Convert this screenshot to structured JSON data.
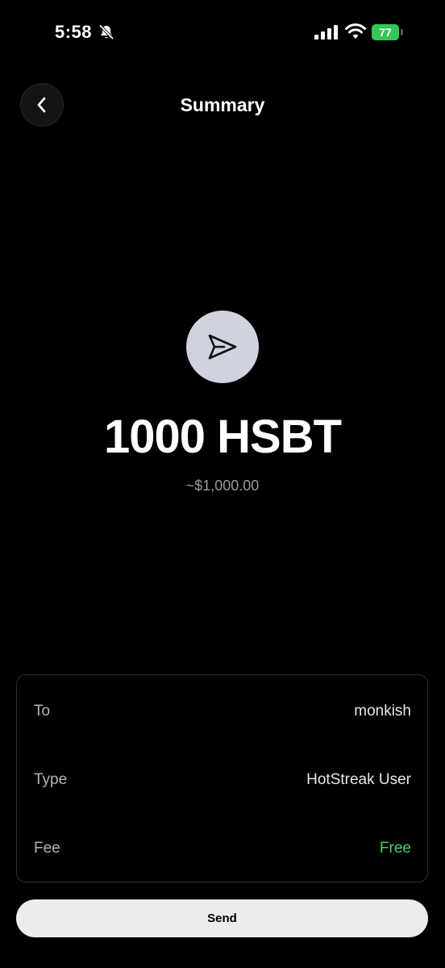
{
  "status_bar": {
    "time": "5:58",
    "battery": "77",
    "icons": [
      "bell-slash-icon",
      "cellular-signal-icon",
      "wifi-icon",
      "battery-charging-icon"
    ]
  },
  "header": {
    "back_icon": "chevron-left-icon",
    "title": "Summary"
  },
  "transaction": {
    "icon": "send-arrow-icon",
    "amount": "1000 HSBT",
    "fiat_value": "~$1,000.00"
  },
  "details": [
    {
      "label": "To",
      "value": "monkish"
    },
    {
      "label": "Type",
      "value": "HotStreak User"
    },
    {
      "label": "Fee",
      "value": "Free"
    }
  ],
  "colors": {
    "background": "#000000",
    "free_accent": "#4ccb6a",
    "icon_circle": "#cfd3df",
    "battery": "#34c759"
  },
  "action": {
    "send_label": "Send"
  }
}
